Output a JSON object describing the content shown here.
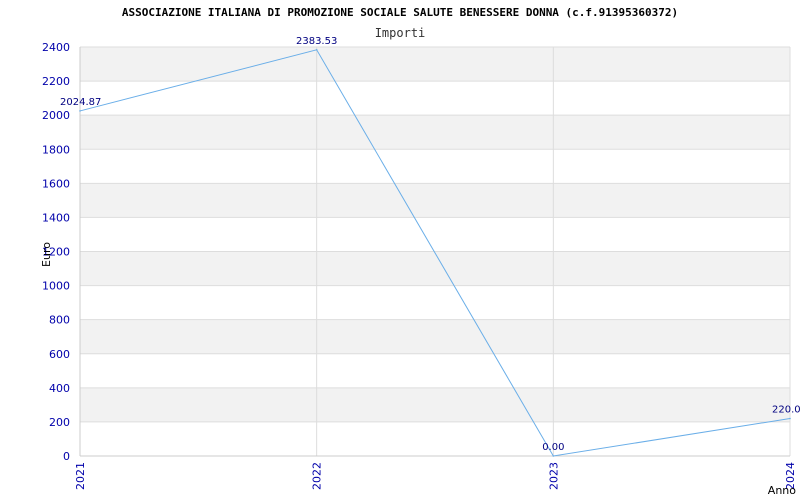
{
  "chart_data": {
    "type": "line",
    "title": "ASSOCIAZIONE ITALIANA DI PROMOZIONE SOCIALE SALUTE BENESSERE DONNA (c.f.91395360372)",
    "subtitle": "Importi",
    "xlabel": "Anno",
    "ylabel": "Euro",
    "x": [
      "2021",
      "2022",
      "2023",
      "2024"
    ],
    "series": [
      {
        "values": [
          2024.87,
          2383.53,
          0.0,
          220.0
        ],
        "labels": [
          "2024.87",
          "2383.53",
          "0.00",
          "220.0"
        ]
      }
    ],
    "ylim": [
      0,
      2400
    ],
    "yticks": [
      0,
      200,
      400,
      600,
      800,
      1000,
      1200,
      1400,
      1600,
      1800,
      2000,
      2200,
      2400
    ],
    "grid": true,
    "colors": {
      "line": "#6aaee8",
      "tick_text": "#0000aa",
      "label_text": "#000080",
      "band": "#f2f2f2",
      "grid": "#dddddd"
    }
  }
}
